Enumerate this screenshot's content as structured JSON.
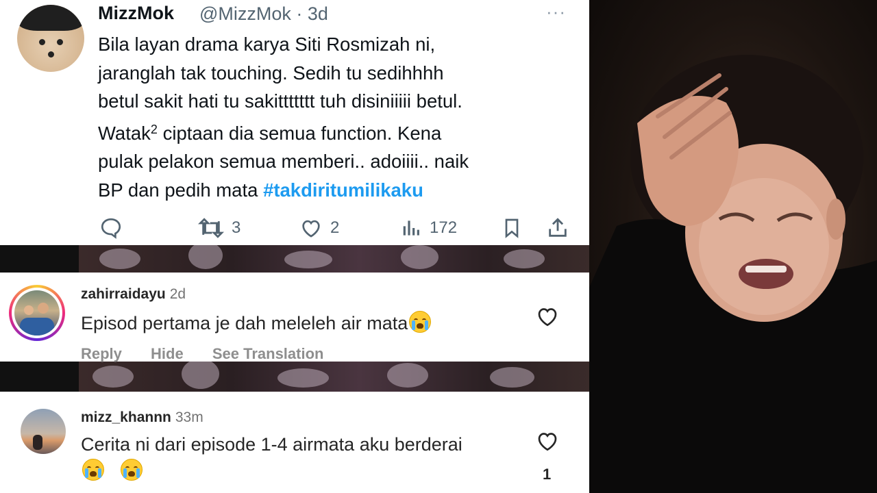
{
  "tweet": {
    "display_name": "MizzMok",
    "handle_time": "@MizzMok · 3d",
    "more_icon": "···",
    "lines": [
      "Bila layan drama karya Siti Rosmizah ni,",
      "jaranglah tak touching. Sedih tu sedihhhh",
      "betul sakit hati tu sakittttttt tuh disiniiiii betul."
    ],
    "line4_before": "Watak",
    "line4_sup": "2",
    "line4_after": " ciptaan dia semua function. Kena",
    "line5": "pulak pelakon semua memberi.. adoiiii.. naik",
    "line6_plain": "BP dan pedih mata ",
    "hashtag": "#takdiritumilikaku",
    "actions": {
      "reply_icon": "reply-icon",
      "retweet_count": "3",
      "like_count": "2",
      "views_count": "172"
    },
    "accent_color": "#1d9bf0"
  },
  "comments": [
    {
      "username": "zahirraidayu",
      "time": "2d",
      "text": "Episod pertama je dah meleleh air mata",
      "emoji": "loudly-crying-face",
      "links": [
        "Reply",
        "Hide",
        "See Translation"
      ]
    },
    {
      "username": "mizz_khannn",
      "time": "33m",
      "text": "Cerita ni dari episode 1-4 airmata aku berderai",
      "emoji": "loudly-crying-face",
      "like_count": "1"
    }
  ]
}
